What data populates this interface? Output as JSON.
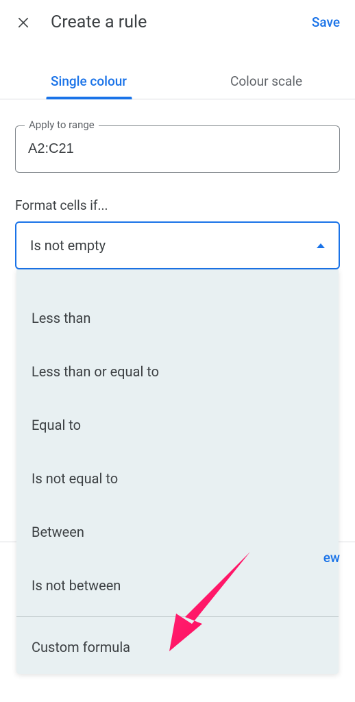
{
  "header": {
    "title": "Create a rule",
    "save_label": "Save"
  },
  "tabs": {
    "single": "Single colour",
    "scale": "Colour scale"
  },
  "range": {
    "label": "Apply to range",
    "value": "A2:C21"
  },
  "format": {
    "label": "Format cells if...",
    "selected": "Is not empty"
  },
  "dropdown_options": {
    "o0": "Less than",
    "o1": "Less than or equal to",
    "o2": "Equal to",
    "o3": "Is not equal to",
    "o4": "Between",
    "o5": "Is not between",
    "o6": "Custom formula"
  },
  "peek": {
    "text": "ew"
  }
}
